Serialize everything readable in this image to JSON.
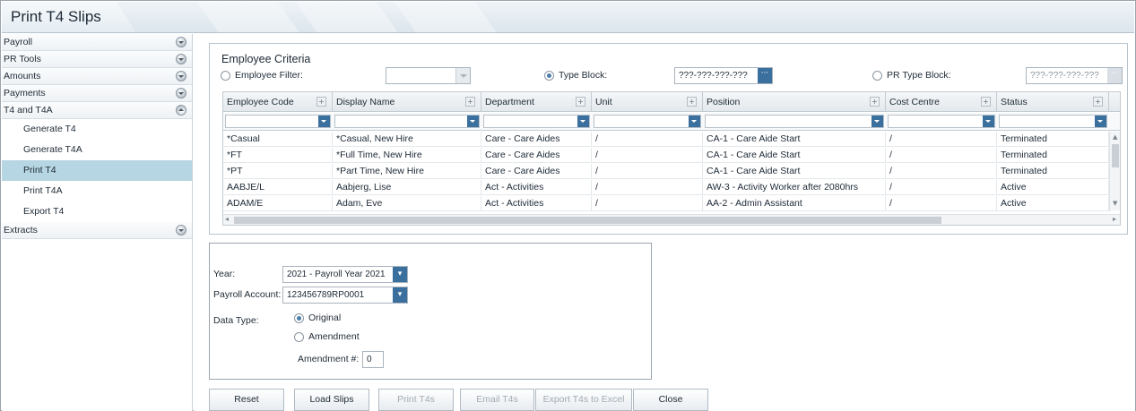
{
  "window": {
    "title": "Print T4 Slips"
  },
  "sidebar": {
    "groups": [
      {
        "label": "Payroll"
      },
      {
        "label": "PR Tools"
      },
      {
        "label": "Amounts"
      },
      {
        "label": "Payments"
      },
      {
        "label": "T4 and T4A"
      }
    ],
    "t4_items": [
      {
        "label": "Generate T4"
      },
      {
        "label": "Generate T4A"
      },
      {
        "label": "Print T4",
        "active": true
      },
      {
        "label": "Print T4A"
      },
      {
        "label": "Export T4"
      }
    ],
    "extracts": {
      "label": "Extracts"
    }
  },
  "criteria": {
    "title": "Employee Criteria",
    "employee_filter_label": "Employee Filter:",
    "employee_filter_value": "",
    "type_block_label": "Type Block:",
    "type_block_value": "???-???-???-???",
    "pr_type_block_label": "PR Type Block:",
    "pr_type_block_value": "???-???-???-???",
    "selected_mode": "Type Block"
  },
  "grid": {
    "columns": [
      "Employee Code",
      "Display Name",
      "Department",
      "Unit",
      "Position",
      "Cost Centre",
      "Status"
    ],
    "rows": [
      [
        "*Casual",
        "*Casual, New Hire",
        "Care - Care Aides",
        "/",
        "CA-1 - Care Aide Start",
        "/",
        "Terminated"
      ],
      [
        "*FT",
        "*Full Time, New Hire",
        "Care - Care Aides",
        "/",
        "CA-1 - Care Aide Start",
        "/",
        "Terminated"
      ],
      [
        "*PT",
        "*Part Time, New Hire",
        "Care - Care Aides",
        "/",
        "CA-1 - Care Aide Start",
        "/",
        "Terminated"
      ],
      [
        "AABJE/L",
        "Aabjerg, Lise",
        "Act - Activities",
        "/",
        "AW-3 - Activity Worker after 2080hrs",
        "/",
        "Active"
      ],
      [
        "ADAM/E",
        "Adam, Eve",
        "Act - Activities",
        "/",
        "AA-2 - Admin Assistant",
        "/",
        "Active"
      ]
    ]
  },
  "params": {
    "year_label": "Year:",
    "year_value": "2021 - Payroll Year 2021",
    "account_label": "Payroll Account:",
    "account_value": "123456789RP0001",
    "data_type_label": "Data Type:",
    "data_type_original": "Original",
    "data_type_amendment": "Amendment",
    "data_type_selected": "Original",
    "amendment_label": "Amendment #:",
    "amendment_value": "0"
  },
  "buttons": {
    "reset": "Reset",
    "load_slips": "Load Slips",
    "print_t4s": "Print T4s",
    "email_t4s": "Email T4s",
    "export_excel": "Export T4s to Excel",
    "close": "Close"
  },
  "colors": {
    "accent": "#3a6f9e",
    "active_item": "#b6d6e3",
    "border": "#b8c4cd"
  }
}
